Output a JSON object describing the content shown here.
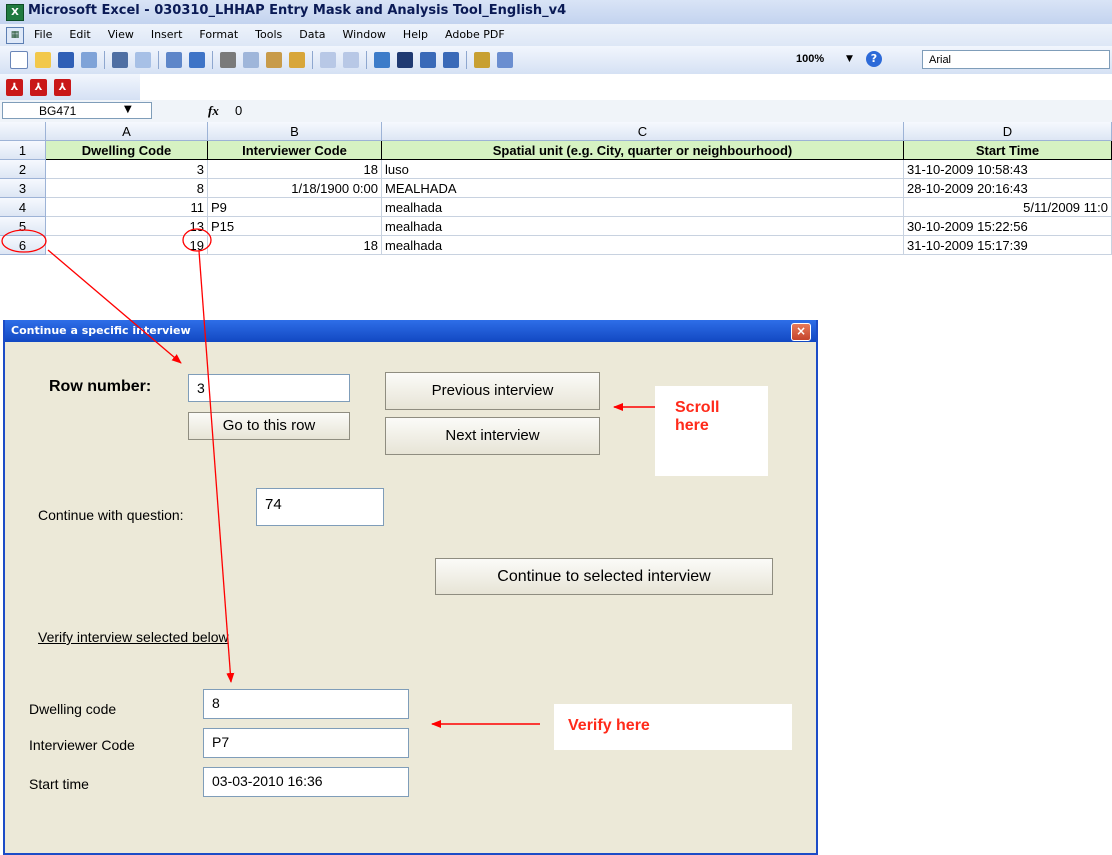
{
  "window": {
    "title": "Microsoft Excel - 030310_LHHAP Entry Mask and Analysis Tool_English_v4"
  },
  "menu": {
    "items": [
      "File",
      "Edit",
      "View",
      "Insert",
      "Format",
      "Tools",
      "Data",
      "Window",
      "Help",
      "Adobe PDF"
    ]
  },
  "toolbar": {
    "zoom": "100%",
    "font": "Arial"
  },
  "formula_bar": {
    "name_box": "BG471",
    "fx_label": "fx",
    "value": "0"
  },
  "grid": {
    "columns": [
      "A",
      "B",
      "C",
      "D"
    ],
    "header_row": {
      "row_number": "1",
      "cells": [
        "Dwelling Code",
        "Interviewer Code",
        "Spatial unit (e.g. City, quarter or neighbourhood)",
        "Start Time"
      ]
    },
    "rows": [
      {
        "row_number": "2",
        "cells": [
          "3",
          "18",
          "luso",
          "31-10-2009 10:58:43"
        ]
      },
      {
        "row_number": "3",
        "cells": [
          "8",
          "1/18/1900 0:00",
          "MEALHADA",
          "28-10-2009 20:16:43"
        ]
      },
      {
        "row_number": "4",
        "cells": [
          "11",
          "P9",
          "mealhada",
          "5/11/2009 11:0"
        ]
      },
      {
        "row_number": "5",
        "cells": [
          "13",
          "P15",
          "mealhada",
          "30-10-2009 15:22:56"
        ]
      },
      {
        "row_number": "6",
        "cells": [
          "19",
          "18",
          "mealhada",
          "31-10-2009 15:17:39"
        ]
      }
    ]
  },
  "dialog": {
    "title": "Continue a specific interview",
    "close": "×",
    "row_number_label": "Row number:",
    "row_number_value": "3",
    "goto_button": "Go to this row",
    "previous_button": "Previous interview",
    "next_button": "Next interview",
    "continue_label": "Continue with question:",
    "continue_value": "74",
    "continue_button": "Continue to selected interview",
    "verify_link": "Verify interview selected below",
    "dwelling_label": "Dwelling code",
    "dwelling_value": "8",
    "interviewer_label": "Interviewer Code",
    "interviewer_value": "P7",
    "start_label": "Start time",
    "start_value": "03-03-2010 16:36"
  },
  "annotations": {
    "scroll_line1": "Scroll",
    "scroll_line2": "here",
    "verify": "Verify here",
    "color": "#ff0000"
  }
}
